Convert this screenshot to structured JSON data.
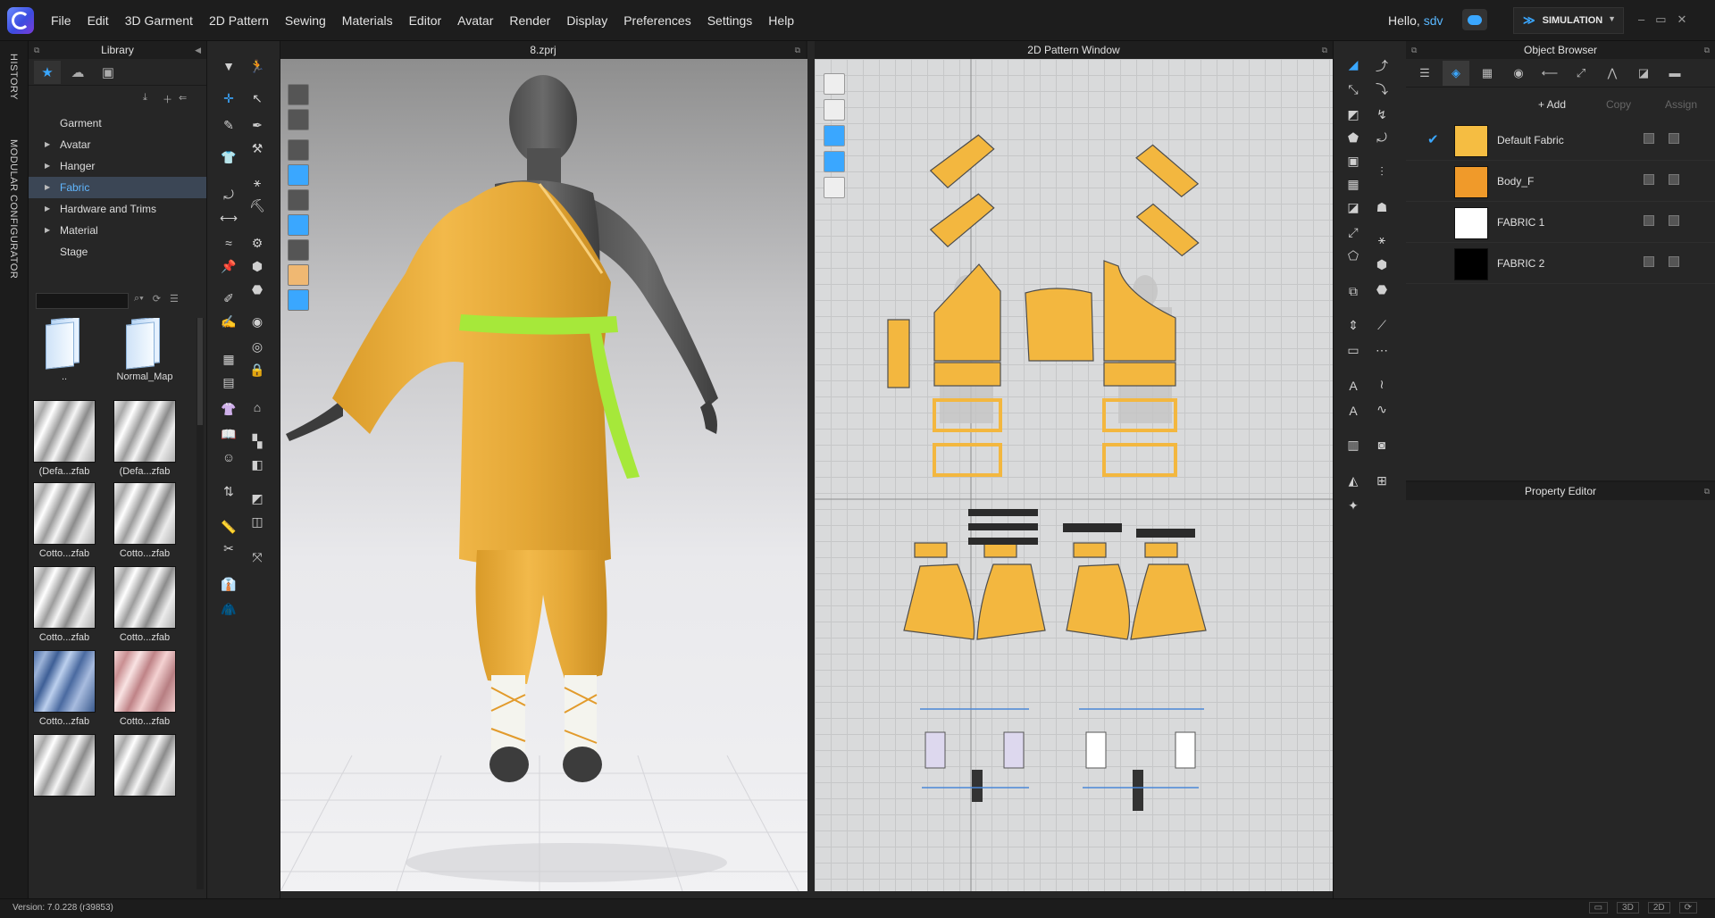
{
  "app": {
    "menus": [
      "File",
      "Edit",
      "3D Garment",
      "2D Pattern",
      "Sewing",
      "Materials",
      "Editor",
      "Avatar",
      "Render",
      "Display",
      "Preferences",
      "Settings",
      "Help"
    ],
    "greeting": "Hello,",
    "user": "sdv",
    "mode": "SIMULATION",
    "version": "Version: 7.0.228 (r39853)"
  },
  "side_tabs": {
    "history": "HISTORY",
    "modular": "MODULAR CONFIGURATOR"
  },
  "library": {
    "title": "Library",
    "tree": [
      {
        "label": "Garment",
        "expandable": false
      },
      {
        "label": "Avatar",
        "expandable": true
      },
      {
        "label": "Hanger",
        "expandable": true
      },
      {
        "label": "Fabric",
        "expandable": true,
        "selected": true
      },
      {
        "label": "Hardware and Trims",
        "expandable": true
      },
      {
        "label": "Material",
        "expandable": true
      },
      {
        "label": "Stage",
        "expandable": false
      }
    ],
    "items": [
      {
        "label": "..",
        "kind": "folder"
      },
      {
        "label": "Normal_Map",
        "kind": "folder"
      },
      {
        "label": "(Defa...zfab",
        "kind": "fabric"
      },
      {
        "label": "(Defa...zfab",
        "kind": "fabric"
      },
      {
        "label": "Cotto...zfab",
        "kind": "fabric"
      },
      {
        "label": "Cotto...zfab",
        "kind": "fabric"
      },
      {
        "label": "Cotto...zfab",
        "kind": "fabric"
      },
      {
        "label": "Cotto...zfab",
        "kind": "fabric"
      },
      {
        "label": "Cotto...zfab",
        "kind": "fabric-blue"
      },
      {
        "label": "Cotto...zfab",
        "kind": "fabric-pink"
      }
    ]
  },
  "viewport3d": {
    "title": "8.zprj"
  },
  "pattern2d": {
    "title": "2D Pattern Window"
  },
  "object_browser": {
    "title": "Object Browser",
    "add_label": "+ Add",
    "copy_label": "Copy",
    "assign_label": "Assign",
    "fabrics": [
      {
        "name": "Default Fabric",
        "color": "#f5bd42",
        "checked": true
      },
      {
        "name": "Body_F",
        "color": "#f09a2a",
        "checked": false
      },
      {
        "name": "FABRIC 1",
        "color": "#ffffff",
        "checked": false
      },
      {
        "name": "FABRIC 2",
        "color": "#000000",
        "checked": false
      }
    ]
  },
  "property_editor": {
    "title": "Property Editor"
  },
  "colors": {
    "accent": "#3aa7ff",
    "garment": "#f0b53e",
    "belt": "#a6e83a"
  }
}
